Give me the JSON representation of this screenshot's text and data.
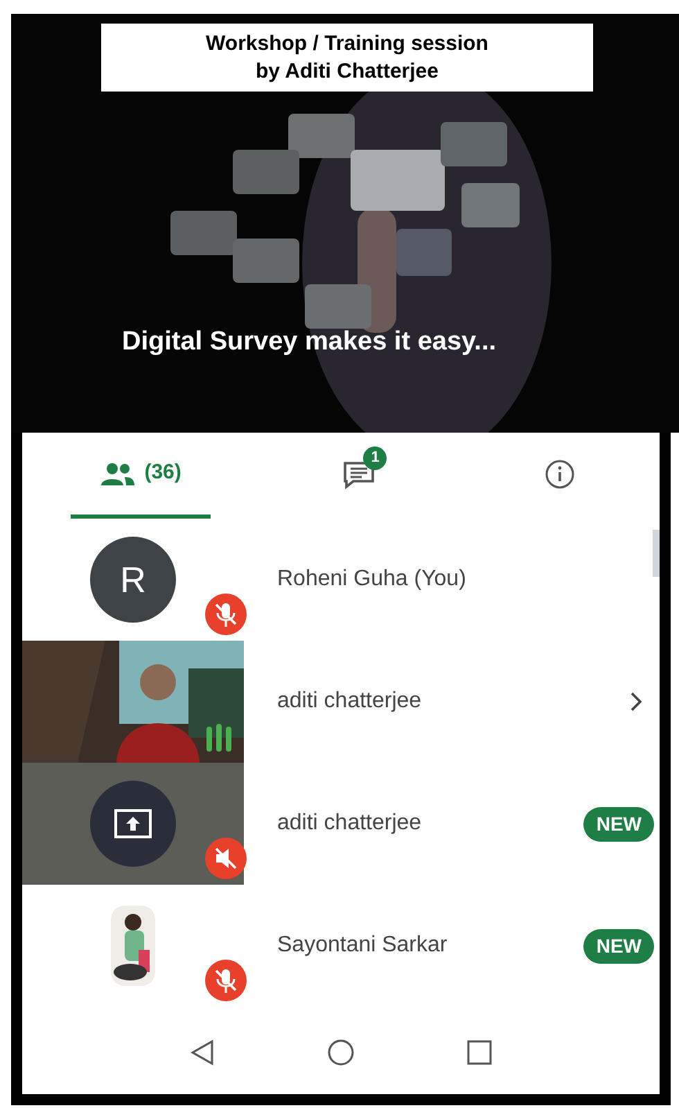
{
  "slide": {
    "title": "Workshop / Training session",
    "subtitle": "by Aditi Chatterjee",
    "caption": "Digital Survey makes it easy..."
  },
  "tabs": [
    {
      "kind": "people",
      "label": "(36)",
      "selected": true
    },
    {
      "kind": "chat",
      "badge": "1",
      "selected": false
    },
    {
      "kind": "info",
      "selected": false
    }
  ],
  "participants": [
    {
      "name": "Roheni Guha (You)",
      "kind": "avatar",
      "initial": "R",
      "muted": true
    },
    {
      "name": "aditi chatterjee",
      "kind": "video",
      "speaking": true,
      "chevron": true,
      "muted": false
    },
    {
      "name": "aditi chatterjee",
      "kind": "screen",
      "muted": true,
      "badge": "NEW"
    },
    {
      "name": "Sayontani Sarkar",
      "muted": true,
      "badge": "NEW"
    }
  ]
}
